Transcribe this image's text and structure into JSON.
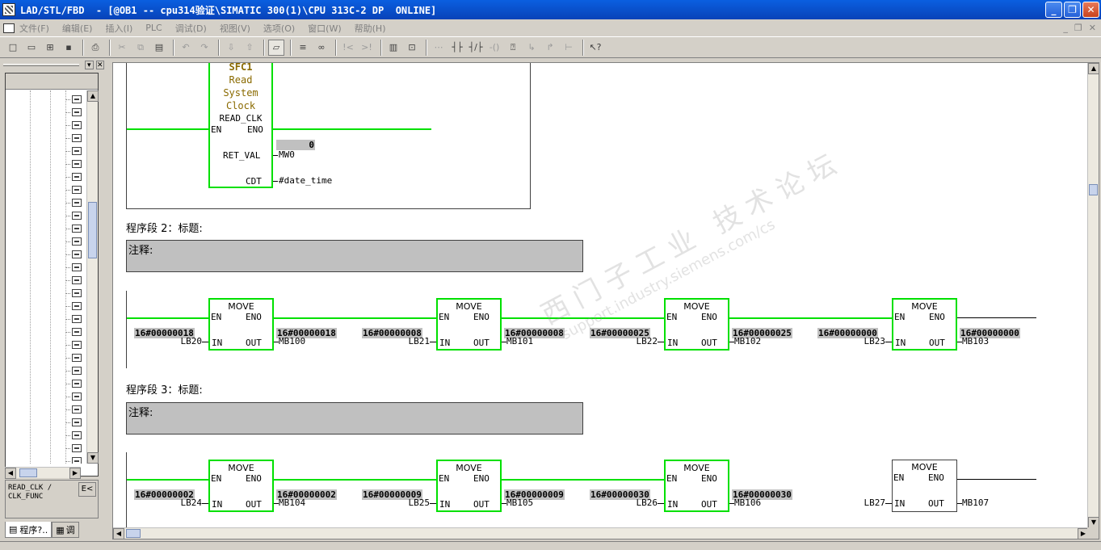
{
  "window": {
    "title": "LAD/STL/FBD  - [@OB1 -- cpu314验证\\SIMATIC 300(1)\\CPU 313C-2 DP  ONLINE]",
    "minimize": "_",
    "restore": "❐",
    "close": "✕"
  },
  "menu": {
    "items": [
      "文件(F)",
      "编辑(E)",
      "插入(I)",
      "PLC",
      "调试(D)",
      "视图(V)",
      "选项(O)",
      "窗口(W)",
      "帮助(H)"
    ],
    "mdi_min": "_",
    "mdi_restore": "❐",
    "mdi_close": "✕"
  },
  "left_panel": {
    "info_line1": "READ_CLK /",
    "info_line2": "CLK_FUNC",
    "info_button": "E<",
    "tab1": "程序?..",
    "tab2": "调",
    "close": "✕"
  },
  "editor": {
    "network1": {
      "block_lines": [
        "SFC1",
        "Read",
        "System",
        "Clock"
      ],
      "block_type": "READ_CLK",
      "en": "EN",
      "eno": "ENO",
      "ret_val_pin": "RET_VAL",
      "cdt_pin": "CDT",
      "ret_val_value": "0",
      "ret_val_operand": "MW0",
      "cdt_operand": "#date_time"
    },
    "network2": {
      "title": "程序段 2：标题:",
      "comment": "注释:",
      "blocks": [
        {
          "name": "MOVE",
          "in_value": "16#00000018",
          "in_operand": "LB20",
          "out_value": "16#00000018",
          "out_operand": "MB100"
        },
        {
          "name": "MOVE",
          "in_value": "16#00000008",
          "in_operand": "LB21",
          "out_value": "16#00000008",
          "out_operand": "MB101"
        },
        {
          "name": "MOVE",
          "in_value": "16#00000025",
          "in_operand": "LB22",
          "out_value": "16#00000025",
          "out_operand": "MB102"
        },
        {
          "name": "MOVE",
          "in_value": "16#00000000",
          "in_operand": "LB23",
          "out_value": "16#00000000",
          "out_operand": "MB103"
        }
      ]
    },
    "network3": {
      "title": "程序段 3：标题:",
      "comment": "注释:",
      "blocks": [
        {
          "name": "MOVE",
          "in_value": "16#00000002",
          "in_operand": "LB24",
          "out_value": "16#00000002",
          "out_operand": "MB104"
        },
        {
          "name": "MOVE",
          "in_value": "16#00000009",
          "in_operand": "LB25",
          "out_value": "16#00000009",
          "out_operand": "MB105"
        },
        {
          "name": "MOVE",
          "in_value": "16#00000030",
          "in_operand": "LB26",
          "out_value": "16#00000030",
          "out_operand": "MB106"
        },
        {
          "name": "MOVE",
          "in_value": "",
          "in_operand": "LB27",
          "out_value": "",
          "out_operand": "MB107"
        }
      ]
    },
    "pins": {
      "en": "EN",
      "eno": "ENO",
      "in": "IN",
      "out": "OUT"
    },
    "watermark": {
      "line1": "西门子工业 技术论坛",
      "line2": "support.industry.siemens.com/cs"
    }
  },
  "colors": {
    "active_rung": "#00e000",
    "title_bar": "#0a5fe0",
    "comment_bg": "#c0c0c0"
  }
}
